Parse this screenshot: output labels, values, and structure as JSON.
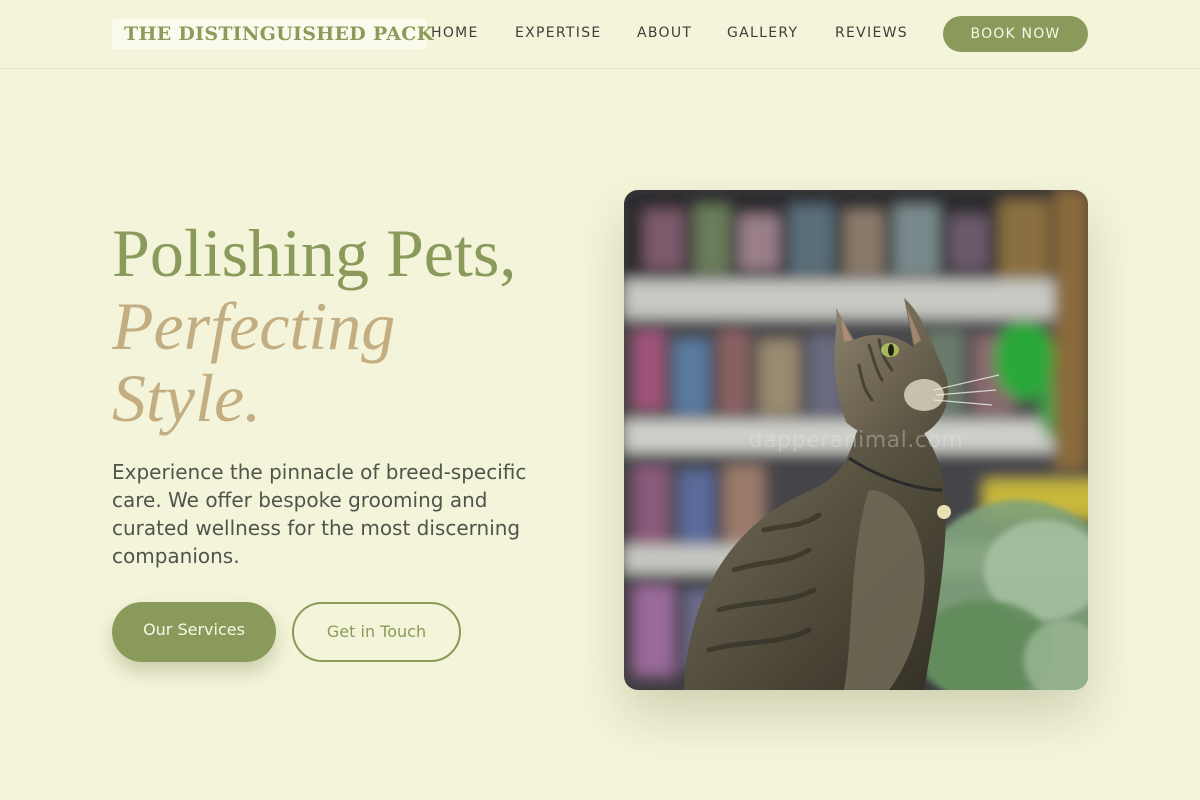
{
  "header": {
    "logo_text": "THE DISTINGUISHED PACK",
    "nav": {
      "home": "HOME",
      "expertise": "EXPERTISE",
      "about": "ABOUT",
      "gallery": "GALLERY",
      "reviews": "REVIEWS"
    },
    "cta_label": "BOOK NOW"
  },
  "hero": {
    "title_line1": "Polishing Pets,",
    "title_line2": "Perfecting",
    "title_line3": "Style.",
    "description": "Experience the pinnacle of breed-specific care. We offer bespoke grooming and curated wellness for the most discerning companions.",
    "primary_button": "Our Services",
    "secondary_button": "Get in Touch",
    "image_watermark": "dapperanimal.com",
    "image_subject": "tabby-cat-in-pet-store"
  },
  "colors": {
    "background": "#f4f4da",
    "olive_accent": "#8a9a5b",
    "tan_accent": "#c2ae82",
    "body_text": "#4e554a"
  }
}
